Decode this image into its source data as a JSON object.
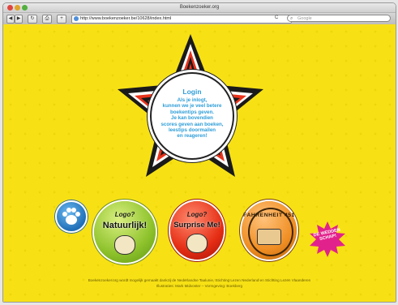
{
  "window": {
    "title": "Boekenzoeker.org"
  },
  "toolbar": {
    "back": "◀",
    "forward": "▶",
    "reload": "↻",
    "print": "⎙",
    "add": "+",
    "url": "http://www.boekenzoeker.be/10628/index.html",
    "reload_symbol": "C",
    "search_placeholder": "Google"
  },
  "login": {
    "title": "Login",
    "lines": [
      "Als je inlogt,",
      "kunnen we je veel betere",
      "boekentips geven.",
      "Je kan bovendien",
      "scores geven aan boeken,",
      "leestips doormailen",
      "en reageren!"
    ]
  },
  "badges": {
    "green_top": "Logo?",
    "green_main": "Natuurlijk!",
    "red_top": "Logo?",
    "red_main": "Surprise Me!",
    "orange_main": "FAHRENHEIT 451",
    "burst_text": "DE WEDDEN SCHAP!"
  },
  "footer": {
    "line1": "Boekenzoeker.org wordt mogelijk gemaakt dankzij de Nederlandse Taalunie, Stichting Lezen Nederland en Stichting Lezen Vlaanderen",
    "line2": "Illustraties: Mark Midvoster – Vormgeving: Boekberg"
  },
  "colors": {
    "page_background": "#f7e115",
    "login_text": "#2f9ed8",
    "star_red": "#e8331c",
    "star_black": "#1a1a1a"
  }
}
